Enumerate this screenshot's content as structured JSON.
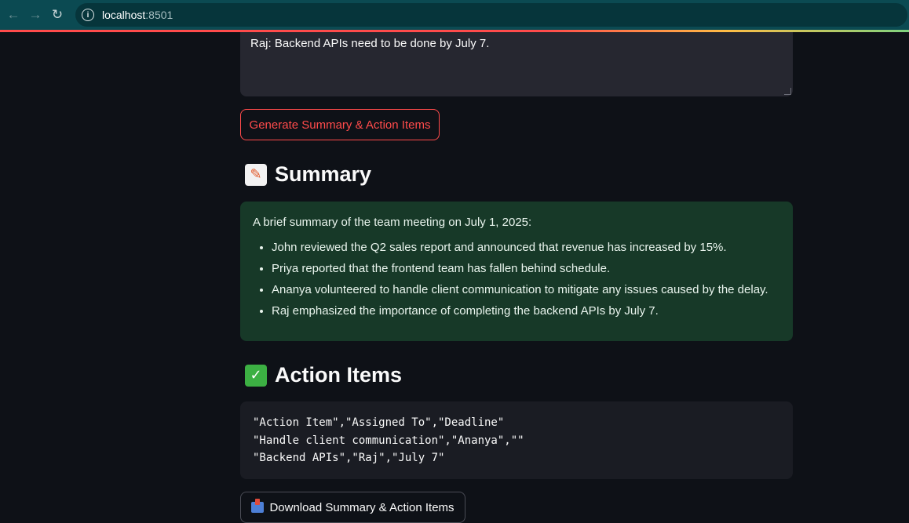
{
  "browser": {
    "back_icon": "arrow-left-icon",
    "forward_icon": "arrow-right-icon",
    "reload_icon": "reload-icon",
    "url_host": "localhost",
    "url_port": ":8501"
  },
  "transcript": {
    "visible_line": "Raj: Backend APIs need to be done by July 7."
  },
  "generate_button": {
    "label": "Generate Summary & Action Items",
    "color": "#ff4b4b"
  },
  "summary": {
    "heading": "Summary",
    "emoji": "memo-icon",
    "intro": "A brief summary of the team meeting on July 1, 2025:",
    "bullets": [
      "John reviewed the Q2 sales report and announced that revenue has increased by 15%.",
      "Priya reported that the frontend team has fallen behind schedule.",
      "Ananya volunteered to handle client communication to mitigate any issues caused by the delay.",
      "Raj emphasized the importance of completing the backend APIs by July 7."
    ],
    "background_color": "#173928"
  },
  "action_items": {
    "heading": "Action Items",
    "emoji": "check-mark-icon",
    "csv_lines": [
      "\"Action Item\",\"Assigned To\",\"Deadline\"",
      "\"Handle client communication\",\"Ananya\",\"\"",
      "\"Backend APIs\",\"Raj\",\"July 7\""
    ]
  },
  "download_button": {
    "label": "Download Summary & Action Items",
    "icon": "inbox-tray-icon"
  }
}
